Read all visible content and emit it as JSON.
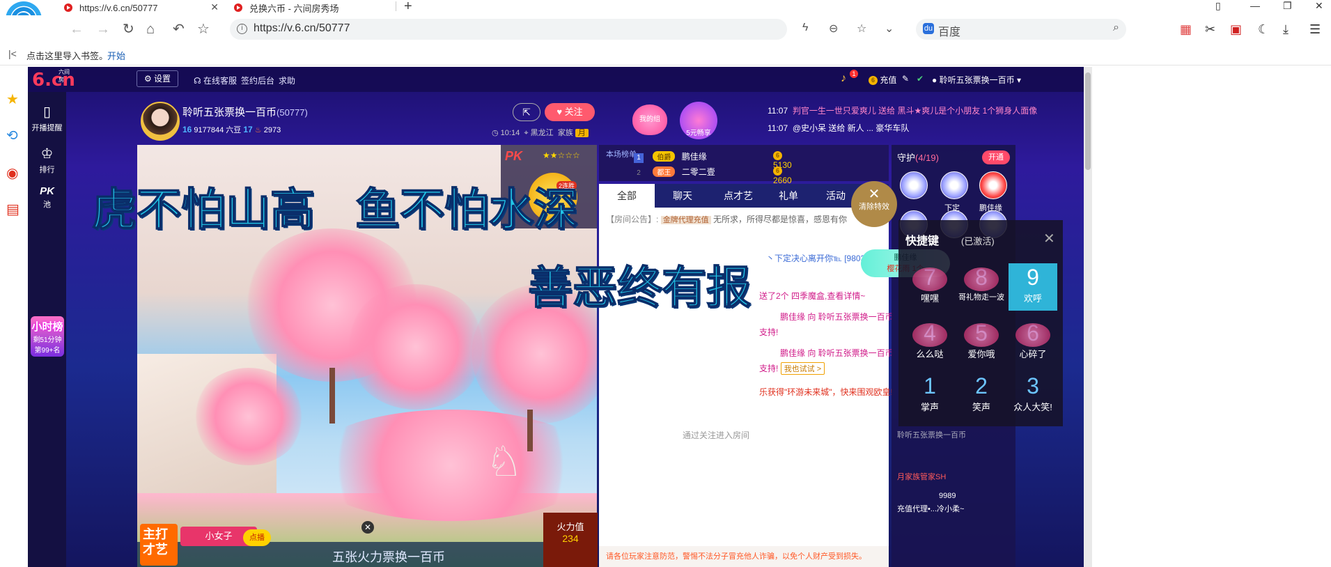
{
  "browser": {
    "tabs": [
      {
        "title": "https://v.6.cn/50777",
        "close": "✕"
      },
      {
        "title": "兑换六币 - 六间房秀场"
      }
    ],
    "new_tab": "+",
    "url": "https://v.6.cn/50777",
    "search_placeholder": "百度",
    "bookmark_hint": "点击这里导入书签。",
    "bookmark_start": "开始"
  },
  "site": {
    "logo": "6.cn",
    "logo_sub": "六间房",
    "settings": "设置",
    "nav_links": [
      "在线客服",
      "签约后台",
      "求助"
    ],
    "bell_count": "1",
    "recharge": "充值",
    "username": "聆听五张票换一百币"
  },
  "left_sidebar": {
    "items": [
      "开播提醒",
      "排行",
      "池"
    ],
    "pk_label": "PK",
    "hour_rank": {
      "title": "小时榜",
      "remain": "剩51分钟",
      "rank": "第99+名"
    }
  },
  "anchor": {
    "name": "聆听五张票换一百币",
    "room_id": "(50777)",
    "level1": "16",
    "beans": "9177844 六豆",
    "level2": "17",
    "fans": "2973",
    "follow": "关注",
    "time": "10:14",
    "location": "黑龙江",
    "family": "家族",
    "family_badge": "月",
    "gift_heart": "我的组",
    "gift_5": "5元畅享"
  },
  "feed": [
    {
      "time": "11:07",
      "text": "判官一生一世只爱爽儿 送给 黑斗★爽儿是个小朋友 1个狮身人面像"
    },
    {
      "time": "11:07",
      "text": "@史小呆 送给 新人 ... 豪华车队"
    }
  ],
  "overlay": {
    "line1": "虎不怕山高",
    "line2": "鱼不怕水深",
    "line3": "善恶终有报",
    "clear_effect": "清除特效",
    "cherry_user": "鹏佳缘",
    "cherry_gift": "樱花雨 1个"
  },
  "pk": {
    "logo": "PK",
    "stars": "★★☆☆☆",
    "tag": "2连胜"
  },
  "rank": {
    "label": "本场榜单",
    "rows": [
      {
        "num": "1",
        "badge": "伯爵",
        "name": "鹏佳缘",
        "value": "5130"
      },
      {
        "num": "2",
        "badge": "都王",
        "name": "二零二壹",
        "value": "2660"
      }
    ]
  },
  "chat": {
    "tabs": [
      "全部",
      "聊天",
      "点才艺",
      "礼单",
      "活动"
    ],
    "announcement_label": "【房间公告】:",
    "announcement_badge": "金牌代理充值",
    "announcement": "无所求，所得尽都是惊喜，感恩有你",
    "lines": [
      "丶下定决心离开你℡ [98038] 对",
      "送了2个 四季魔盒,查看详情~",
      "鹏佳缘 向 聆听五张票换一百币",
      "支持!",
      "鹏佳缘 向 聆听五张票换一百币",
      "支持!",
      "乐获得\"环游未来城\"，快来围观欧皇!",
      "通过关注进入房间"
    ],
    "try_btn": "我也试试 >",
    "notice": "请各位玩家注意防范，警惕不法分子冒充他人诈骗，以免个人财产受到损失。"
  },
  "guard": {
    "title": "守护",
    "count": "(4/19)",
    "open": "开通",
    "members": [
      "下定",
      "鹏佳缘"
    ],
    "bottom_items": [
      "聆听五张票换一百币",
      "月家族管家SH",
      "9989",
      "充值代理•...冷小柔~"
    ]
  },
  "shortcut": {
    "title": "快捷键",
    "status": "(已激活)",
    "close": "✕",
    "cells": [
      {
        "num": "7",
        "label": "嘿嘿"
      },
      {
        "num": "8",
        "label": "哥礼物走一波"
      },
      {
        "num": "9",
        "label": "欢呼"
      },
      {
        "num": "4",
        "label": "么么哒"
      },
      {
        "num": "5",
        "label": "爱你哦"
      },
      {
        "num": "6",
        "label": "心碎了"
      },
      {
        "num": "1",
        "label": "掌声"
      },
      {
        "num": "2",
        "label": "笑声"
      },
      {
        "num": "3",
        "label": "众人大笑!"
      }
    ]
  },
  "video": {
    "host_a": "主打才艺",
    "host_b": "小女子",
    "dianbo": "点播",
    "bottom_text": "五张火力票换一百币",
    "fire_label": "火力值",
    "fire_value": "234"
  }
}
